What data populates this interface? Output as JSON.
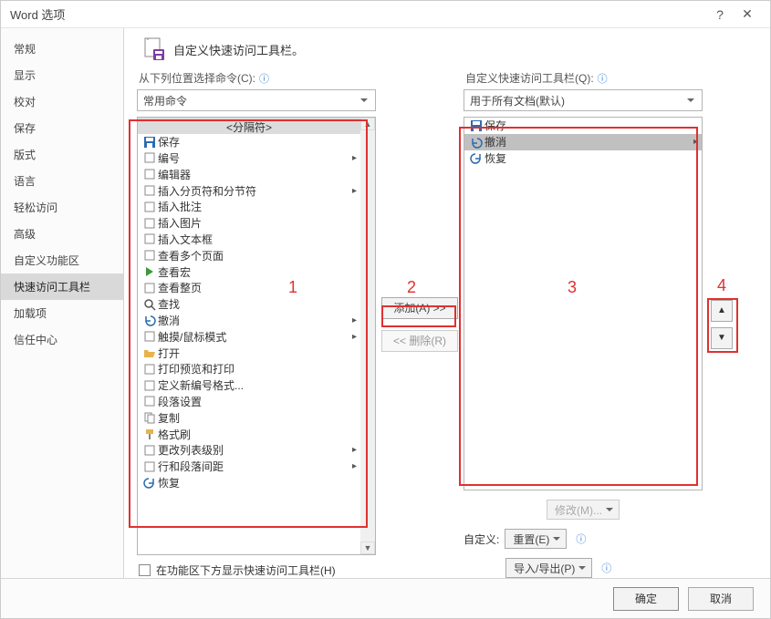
{
  "title": "Word 选项",
  "sidebar": {
    "items": [
      {
        "label": "常规"
      },
      {
        "label": "显示"
      },
      {
        "label": "校对"
      },
      {
        "label": "保存"
      },
      {
        "label": "版式"
      },
      {
        "label": "语言"
      },
      {
        "label": "轻松访问"
      },
      {
        "label": "高级"
      },
      {
        "label": "自定义功能区"
      },
      {
        "label": "快速访问工具栏",
        "selected": true
      },
      {
        "label": "加载项"
      },
      {
        "label": "信任中心"
      }
    ]
  },
  "header": "自定义快速访问工具栏。",
  "left": {
    "label": "从下列位置选择命令(C):",
    "select": "常用命令",
    "list_header": "<分隔符>",
    "items": [
      {
        "icon": "save",
        "label": "保存"
      },
      {
        "icon": "num",
        "label": "编号",
        "arrow": true
      },
      {
        "icon": "editor",
        "label": "编辑器"
      },
      {
        "icon": "break",
        "label": "插入分页符和分节符",
        "arrow": true
      },
      {
        "icon": "comment",
        "label": "插入批注"
      },
      {
        "icon": "pic",
        "label": "插入图片"
      },
      {
        "icon": "textbox",
        "label": "插入文本框"
      },
      {
        "icon": "pages",
        "label": "查看多个页面"
      },
      {
        "icon": "play",
        "label": "查看宏"
      },
      {
        "icon": "page",
        "label": "查看整页"
      },
      {
        "icon": "find",
        "label": "查找"
      },
      {
        "icon": "undo",
        "label": "撤消",
        "arrow": true
      },
      {
        "icon": "touch",
        "label": "触摸/鼠标模式",
        "arrow": true
      },
      {
        "icon": "open",
        "label": "打开"
      },
      {
        "icon": "printprev",
        "label": "打印预览和打印"
      },
      {
        "icon": "defnum",
        "label": "定义新编号格式..."
      },
      {
        "icon": "para",
        "label": "段落设置"
      },
      {
        "icon": "copy",
        "label": "复制"
      },
      {
        "icon": "fmt",
        "label": "格式刷"
      },
      {
        "icon": "lvl",
        "label": "更改列表级别",
        "arrow": true
      },
      {
        "icon": "spacing",
        "label": "行和段落间距",
        "arrow": true
      },
      {
        "icon": "redo",
        "label": "恢复"
      }
    ],
    "show_below_label": "在功能区下方显示快速访问工具栏(H)"
  },
  "mid": {
    "add": "添加(A) >>",
    "remove": "<< 删除(R)"
  },
  "right": {
    "label": "自定义快速访问工具栏(Q):",
    "select": "用于所有文档(默认)",
    "items": [
      {
        "icon": "save",
        "label": "保存"
      },
      {
        "icon": "undo",
        "label": "撤消",
        "selected": true,
        "arrow": true
      },
      {
        "icon": "redo",
        "label": "恢复"
      }
    ],
    "modify": "修改(M)...",
    "custom_label": "自定义:",
    "reset": "重置(E)",
    "impexp": "导入/导出(P)"
  },
  "annotations": {
    "n1": "1",
    "n2": "2",
    "n3": "3",
    "n4": "4"
  },
  "footer": {
    "ok": "确定",
    "cancel": "取消"
  }
}
